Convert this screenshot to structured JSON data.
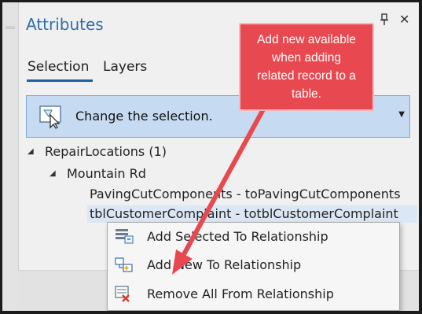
{
  "pane": {
    "title": "Attributes",
    "tabs": [
      {
        "label": "Selection",
        "selected": true
      },
      {
        "label": "Layers",
        "selected": false
      }
    ],
    "pin_icon": "pin-icon",
    "close_glyph": "✕"
  },
  "selection_combo": {
    "label": "Change the selection.",
    "icon": "select-features-icon"
  },
  "tree": {
    "root": "RepairLocations (1)",
    "feature": "Mountain Rd",
    "relationships": [
      "PavingCutComponents - toPavingCutComponents",
      "tblCustomerComplaint - totblCustomerComplaint"
    ]
  },
  "context_menu": {
    "items": [
      {
        "label": "Add Selected To Relationship",
        "icon": "add-selected-icon"
      },
      {
        "label": "Add New To Relationship",
        "icon": "add-new-icon"
      },
      {
        "label": "Remove All From Relationship",
        "icon": "remove-all-icon"
      }
    ]
  },
  "callout": {
    "text": "Add new available when adding related record to a table.",
    "lines": [
      "Add new available",
      "when adding",
      "related record to a",
      "table."
    ],
    "color": "#e8484f"
  },
  "colors": {
    "accent": "#2e6fae",
    "combo_bg": "#c6dbf2",
    "selection_bg": "#dbe7f4"
  }
}
